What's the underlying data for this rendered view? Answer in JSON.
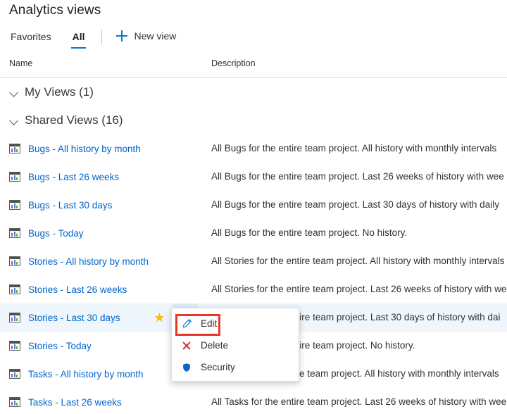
{
  "page": {
    "title": "Analytics views"
  },
  "tabs": [
    {
      "label": "Favorites",
      "active": false
    },
    {
      "label": "All",
      "active": true
    }
  ],
  "commands": {
    "new_view_label": "New view",
    "new_view_icon": "plus-icon"
  },
  "columns": {
    "name": "Name",
    "description": "Description"
  },
  "groups": [
    {
      "label": "My Views (1)",
      "expanded": true,
      "rows": []
    },
    {
      "label": "Shared Views (16)",
      "expanded": true,
      "rows": [
        {
          "name": "Bugs - All history by month",
          "description": "All Bugs for the entire team project. All history with monthly intervals",
          "selected": false
        },
        {
          "name": "Bugs - Last 26 weeks",
          "description": "All Bugs for the entire team project. Last 26 weeks of history with wee",
          "selected": false
        },
        {
          "name": "Bugs - Last 30 days",
          "description": "All Bugs for the entire team project. Last 30 days of history with daily",
          "selected": false
        },
        {
          "name": "Bugs - Today",
          "description": "All Bugs for the entire team project. No history.",
          "selected": false
        },
        {
          "name": "Stories - All history by month",
          "description": "All Stories for the entire team project. All history with monthly intervals",
          "selected": false
        },
        {
          "name": "Stories - Last 26 weeks",
          "description": "All Stories for the entire team project. Last 26 weeks of history with we",
          "selected": false
        },
        {
          "name": "Stories - Last 30 days",
          "description": "All Stories for the entire team project. Last 30 days of history with dai",
          "selected": true
        },
        {
          "name": "Stories - Today",
          "description": "All Stories for the entire team project. No history.",
          "selected": false
        },
        {
          "name": "Tasks - All history by month",
          "description": "All Tasks for the entire team project. All history with monthly intervals",
          "selected": false
        },
        {
          "name": "Tasks - Last 26 weeks",
          "description": "All Tasks for the entire team project. Last 26 weeks of history with wee",
          "selected": false
        }
      ]
    }
  ],
  "selected_row": {
    "star_icon": "star-filled-icon",
    "ellipsis_label": "•••"
  },
  "context_menu": {
    "items": [
      {
        "label": "Edit",
        "icon": "pencil-icon",
        "highlighted": true
      },
      {
        "label": "Delete",
        "icon": "close-x-icon",
        "highlighted": false
      },
      {
        "label": "Security",
        "icon": "shield-icon",
        "highlighted": false
      }
    ]
  },
  "colors": {
    "accent": "#0078d4",
    "link": "#0066cc",
    "selected_row_bg": "#eff6fc",
    "ellipsis_hover_bg": "#deecf9",
    "star": "#ffb900",
    "delete_red": "#d13438",
    "shield_blue": "#0078d4",
    "annotation_red": "#e8382b"
  }
}
